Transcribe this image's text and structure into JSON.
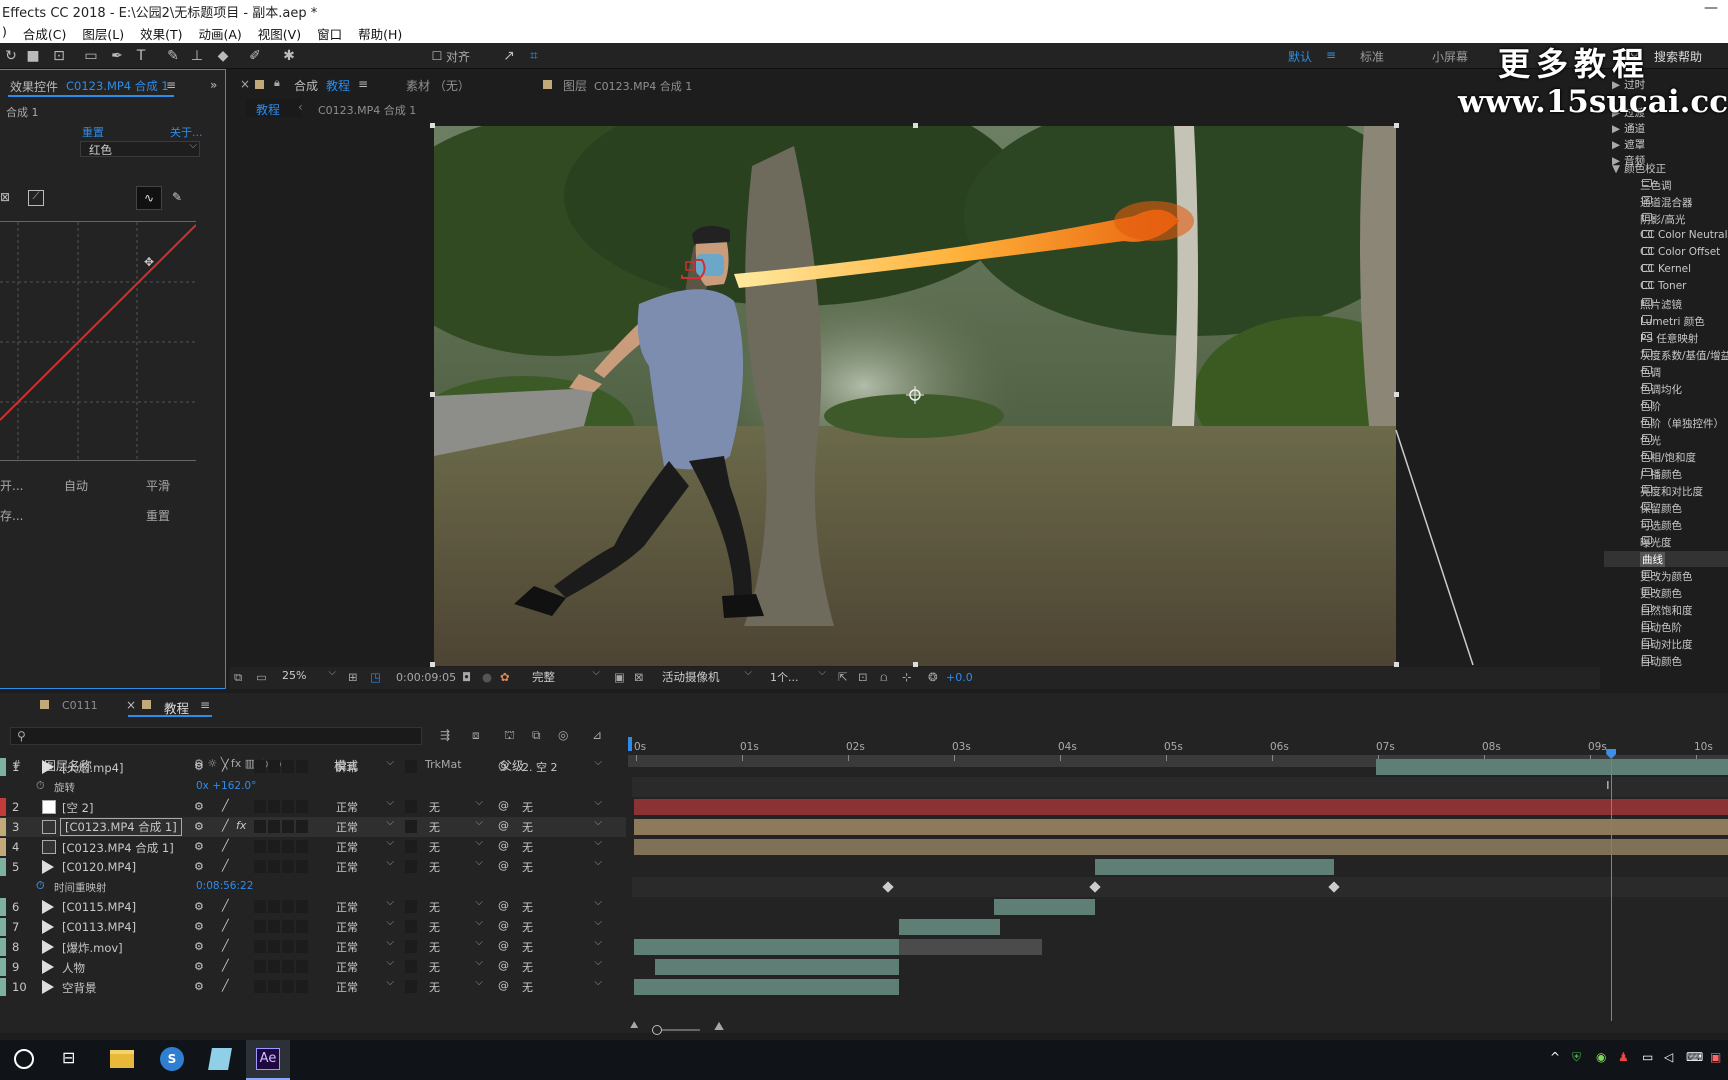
{
  "window": {
    "title": "Effects CC 2018 - E:\\公园2\\无标题项目 - 副本.aep *"
  },
  "menu": [
    "合成(C)",
    "图层(L)",
    "效果(T)",
    "动画(A)",
    "视图(V)",
    "窗口",
    "帮助(H)"
  ],
  "toolbar": {
    "align_label": "对齐",
    "workspaces": [
      "默认",
      "标准",
      "小屏幕"
    ],
    "search_help_placeholder": "搜索帮助"
  },
  "watermark": {
    "line1": "更多教程",
    "line2": "www.15sucai.cc"
  },
  "effects_controls": {
    "tab_label": "效果控件",
    "tab_layer": "C0123.MP4 合成 1",
    "comp_line": "合成 1",
    "reset_label": "重置",
    "about_label": "关于...",
    "channel_value": "红色",
    "auto_label": "自动",
    "smooth_label": "平滑",
    "reset2_label": "重置",
    "open_partial": "开...",
    "save_partial": "存..."
  },
  "comp_panel": {
    "comp_tab_prefix": "合成",
    "comp_tab_name": "教程",
    "footage_tab": "素材 （无）",
    "layer_tab_prefix": "图层",
    "layer_tab_name": "C0123.MP4 合成 1",
    "breadcrumb_active": "教程",
    "breadcrumb_next": "C0123.MP4 合成 1"
  },
  "comp_toolbar": {
    "zoom": "25%",
    "timecode": "0:00:09:05",
    "resolution": "完整",
    "camera": "活动摄像机",
    "views": "1个...",
    "exposure": "+0.0"
  },
  "effects_panel": {
    "categories": [
      "过时",
      "过渡",
      "通道",
      "遮罩",
      "音频",
      "颜色校正"
    ],
    "items": [
      "三色调",
      "通道混合器",
      "阴影/高光",
      "CC Color Neutralizer",
      "CC Color Offset",
      "CC Kernel",
      "CC Toner",
      "照片滤镜",
      "Lumetri 颜色",
      "PS 任意映射",
      "灰度系数/基值/增益",
      "色调",
      "色调均化",
      "色阶",
      "色阶（单独控件）",
      "色光",
      "色相/饱和度",
      "广播颜色",
      "亮度和对比度",
      "保留颜色",
      "可选颜色",
      "曝光度",
      "曲线",
      "更改为颜色",
      "更改颜色",
      "自然饱和度",
      "自动色阶",
      "自动对比度",
      "自动颜色"
    ],
    "selected": "曲线"
  },
  "timeline": {
    "tab_inactive": "C0111",
    "tab_active": "教程",
    "col_num": "#",
    "col_name": "图层名称",
    "col_mode": "模式",
    "col_t": "T",
    "col_trkmat": "TrkMat",
    "col_parent": "父级",
    "ruler": [
      "0s",
      "01s",
      "02s",
      "03s",
      "04s",
      "05s",
      "06s",
      "07s",
      "08s",
      "09s",
      "10s"
    ],
    "playhead_time_s": 9.2,
    "layers": [
      {
        "num": "1",
        "name": "[火焰.mp4]",
        "mode": "屏幕",
        "trk": "",
        "parent": "2. 空 2",
        "color": "#7fb1a3",
        "icon": "video",
        "start": 7.0,
        "end": 10.5,
        "bar": "#5f7f76"
      },
      {
        "num": "",
        "name": "旋转",
        "prop": true,
        "value": "0x +162.0°"
      },
      {
        "num": "2",
        "name": "[空 2]",
        "mode": "正常",
        "trk": "无",
        "parent": "无",
        "color": "#c33b3b",
        "icon": "null",
        "start": 0.0,
        "end": 10.5,
        "bar": "#8a3234"
      },
      {
        "num": "3",
        "name": "[C0123.MP4 合成 1]",
        "mode": "正常",
        "trk": "无",
        "parent": "无",
        "color": "#c2a97a",
        "icon": "comp",
        "start": 0.0,
        "end": 10.5,
        "bar": "#8c7a5b",
        "fx": "fx",
        "selected": true
      },
      {
        "num": "4",
        "name": "[C0123.MP4 合成 1]",
        "mode": "正常",
        "trk": "无",
        "parent": "无",
        "color": "#c2a97a",
        "icon": "comp",
        "start": 0.0,
        "end": 10.5,
        "bar": "#7f7058"
      },
      {
        "num": "5",
        "name": "[C0120.MP4]",
        "mode": "正常",
        "trk": "无",
        "parent": "无",
        "color": "#7fb1a3",
        "icon": "video",
        "start": 4.35,
        "end": 6.6,
        "bar": "#5f7f76"
      },
      {
        "num": "",
        "name": "时间重映射",
        "prop": true,
        "value": "0:08:56:22"
      },
      {
        "num": "6",
        "name": "[C0115.MP4]",
        "mode": "正常",
        "trk": "无",
        "parent": "无",
        "color": "#7fb1a3",
        "icon": "video",
        "start": 3.4,
        "end": 4.35,
        "bar": "#5f7f76"
      },
      {
        "num": "7",
        "name": "[C0113.MP4]",
        "mode": "正常",
        "trk": "无",
        "parent": "无",
        "color": "#7fb1a3",
        "icon": "video",
        "start": 2.5,
        "end": 3.45,
        "bar": "#5f7f76"
      },
      {
        "num": "8",
        "name": "[爆炸.mov]",
        "mode": "正常",
        "trk": "无",
        "parent": "无",
        "color": "#7fb1a3",
        "icon": "video",
        "start": 0.0,
        "end": 3.85,
        "bar": "#5f7f76"
      },
      {
        "num": "9",
        "name": "人物",
        "mode": "正常",
        "trk": "无",
        "parent": "无",
        "color": "#7fb1a3",
        "icon": "video",
        "start": 0.2,
        "end": 2.5,
        "bar": "#5f7f76"
      },
      {
        "num": "10",
        "name": "空背景",
        "mode": "正常",
        "trk": "无",
        "parent": "无",
        "color": "#7fb1a3",
        "icon": "video",
        "start": 0.0,
        "end": 2.5,
        "bar": "#5f7f76"
      }
    ],
    "keyframes_s": [
      2.4,
      4.35,
      6.6
    ]
  },
  "taskbar": {
    "apps": [
      "start-button",
      "task-view",
      "file-explorer",
      "sogou",
      "notepad",
      "after-effects"
    ],
    "ae_label": "Ae"
  }
}
